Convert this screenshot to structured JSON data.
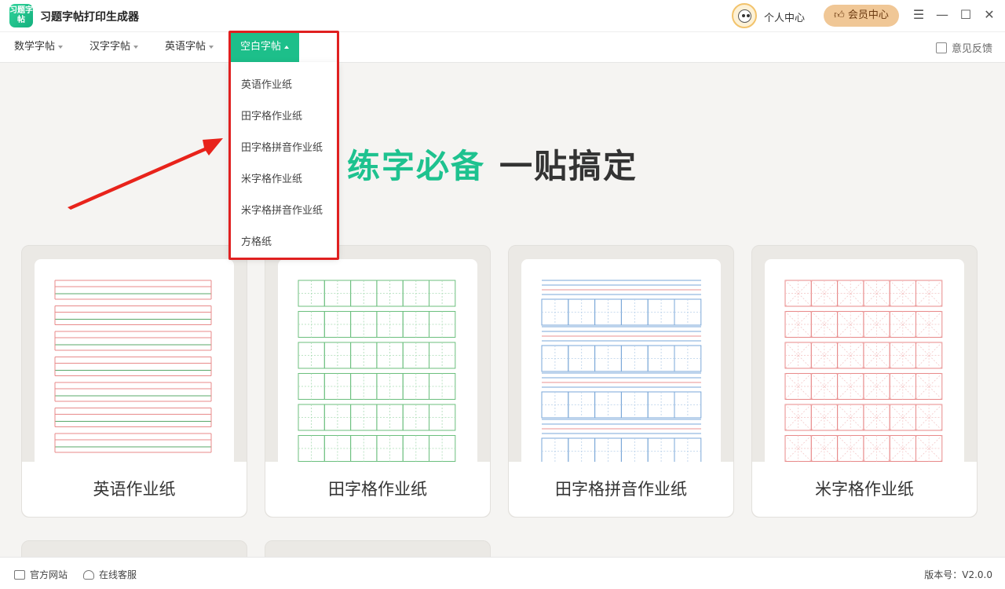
{
  "app": {
    "logo_text": "习题字帖",
    "title": "习题字帖打印生成器"
  },
  "header": {
    "user_center": "个人中心",
    "vip_center": "会员中心"
  },
  "tabs": [
    {
      "label": "数学字帖"
    },
    {
      "label": "汉字字帖"
    },
    {
      "label": "英语字帖"
    },
    {
      "label": "空白字帖"
    }
  ],
  "feedback": "意见反馈",
  "dropdown": {
    "items": [
      "英语作业纸",
      "田字格作业纸",
      "田字格拼音作业纸",
      "米字格作业纸",
      "米字格拼音作业纸",
      "方格纸"
    ]
  },
  "slogan": {
    "part1": "练字必备",
    "part2": "一贴搞定"
  },
  "cards": [
    {
      "label": "英语作业纸"
    },
    {
      "label": "田字格作业纸"
    },
    {
      "label": "田字格拼音作业纸"
    },
    {
      "label": "米字格作业纸"
    }
  ],
  "status": {
    "website": "官方网站",
    "service": "在线客服",
    "version": "版本号：V2.0.0"
  },
  "colors": {
    "accent": "#1dbf8a",
    "highlight": "#e02020",
    "vip": "#f0c796"
  }
}
